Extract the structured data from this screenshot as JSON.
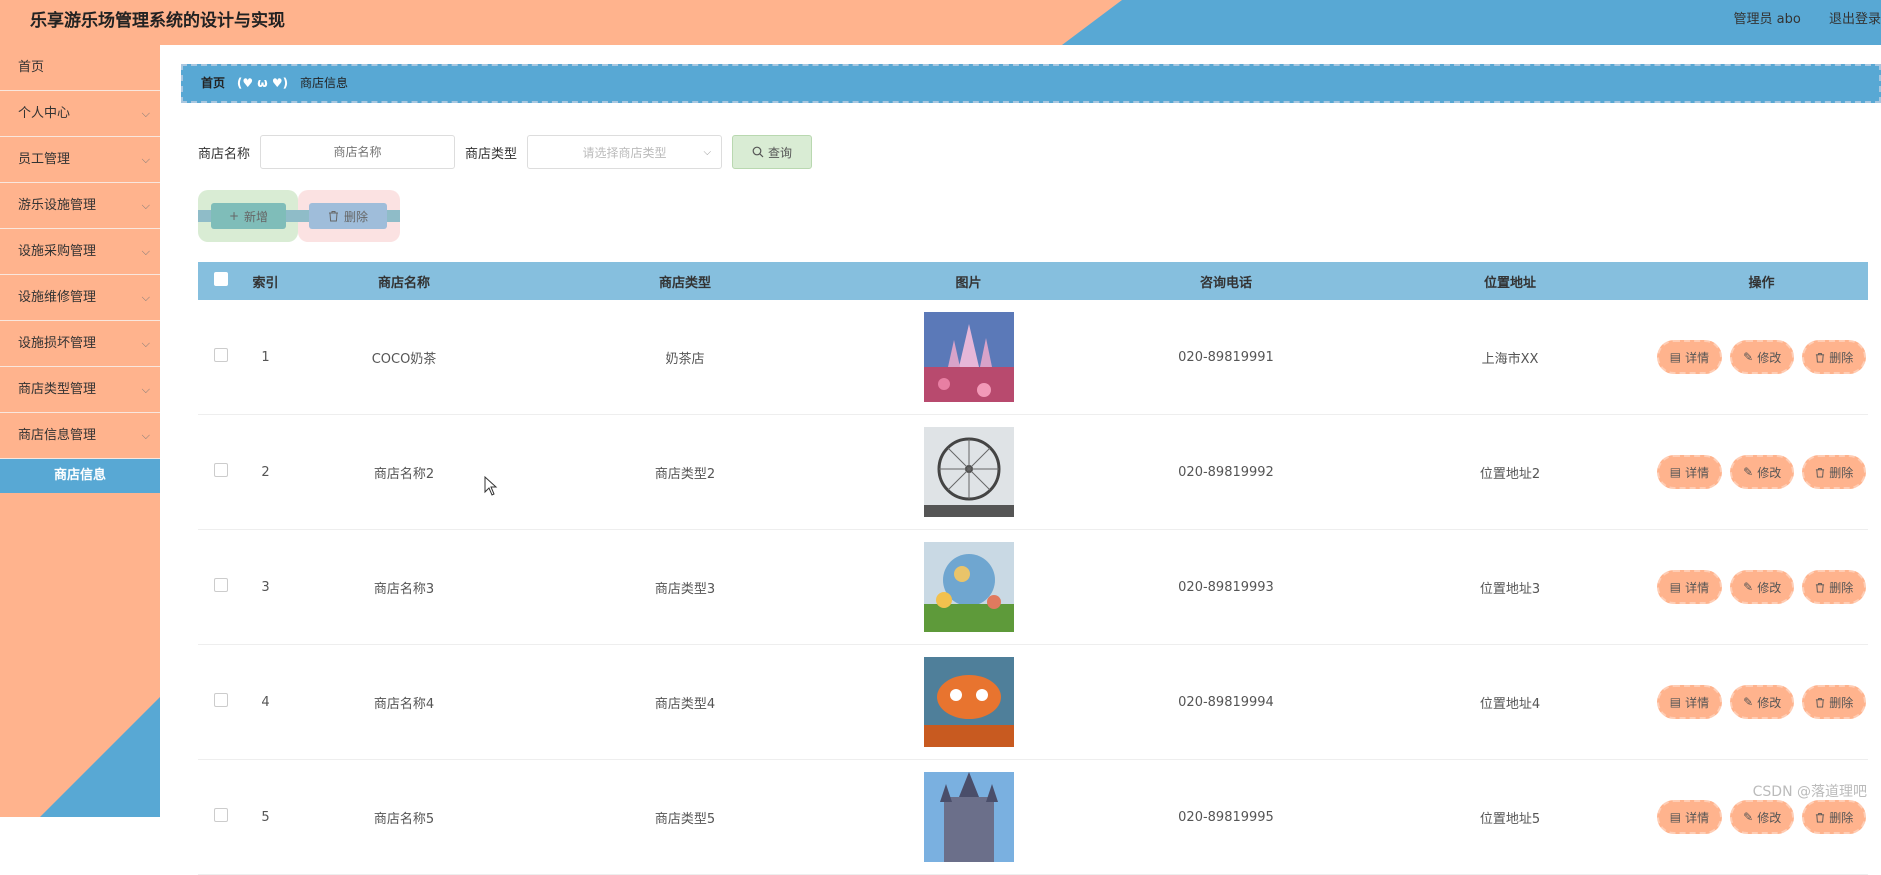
{
  "app": {
    "title": "乐享游乐场管理系统的设计与实现",
    "admin_label": "管理员 abo",
    "logout": "退出登录"
  },
  "sidebar": {
    "items": [
      {
        "label": "首页",
        "has_chevron": false
      },
      {
        "label": "个人中心",
        "has_chevron": true
      },
      {
        "label": "员工管理",
        "has_chevron": true
      },
      {
        "label": "游乐设施管理",
        "has_chevron": true
      },
      {
        "label": "设施采购管理",
        "has_chevron": true
      },
      {
        "label": "设施维修管理",
        "has_chevron": true
      },
      {
        "label": "设施损坏管理",
        "has_chevron": true
      },
      {
        "label": "商店类型管理",
        "has_chevron": true
      },
      {
        "label": "商店信息管理",
        "has_chevron": true
      }
    ],
    "active_sub": "商店信息"
  },
  "breadcrumb": {
    "home": "首页",
    "separator": "(♥ ω ♥)",
    "current": "商店信息"
  },
  "search": {
    "name_label": "商店名称",
    "name_placeholder": "商店名称",
    "type_label": "商店类型",
    "type_placeholder": "请选择商店类型",
    "query": "查询"
  },
  "actions": {
    "add": "新增",
    "delete": "删除"
  },
  "table": {
    "headers": {
      "index": "索引",
      "name": "商店名称",
      "type": "商店类型",
      "image": "图片",
      "phone": "咨询电话",
      "address": "位置地址",
      "ops": "操作"
    },
    "ops": {
      "detail": "详情",
      "edit": "修改",
      "delete": "删除"
    },
    "rows": [
      {
        "index": "1",
        "name": "COCO奶茶",
        "type": "奶茶店",
        "phone": "020-89819991",
        "address": "上海市XX",
        "thumb": "castle-pink"
      },
      {
        "index": "2",
        "name": "商店名称2",
        "type": "商店类型2",
        "phone": "020-89819992",
        "address": "位置地址2",
        "thumb": "ferris-wheel"
      },
      {
        "index": "3",
        "name": "商店名称3",
        "type": "商店类型3",
        "phone": "020-89819993",
        "address": "位置地址3",
        "thumb": "globe-garden"
      },
      {
        "index": "4",
        "name": "商店名称4",
        "type": "商店类型4",
        "phone": "020-89819994",
        "address": "位置地址4",
        "thumb": "orange-ride"
      },
      {
        "index": "5",
        "name": "商店名称5",
        "type": "商店类型5",
        "phone": "020-89819995",
        "address": "位置地址5",
        "thumb": "castle-blue"
      }
    ]
  },
  "watermark": "CSDN @落道理吧",
  "colors": {
    "primary_blue": "#58a8d4",
    "accent_orange": "#ffb38d",
    "table_header": "#86bfde"
  }
}
